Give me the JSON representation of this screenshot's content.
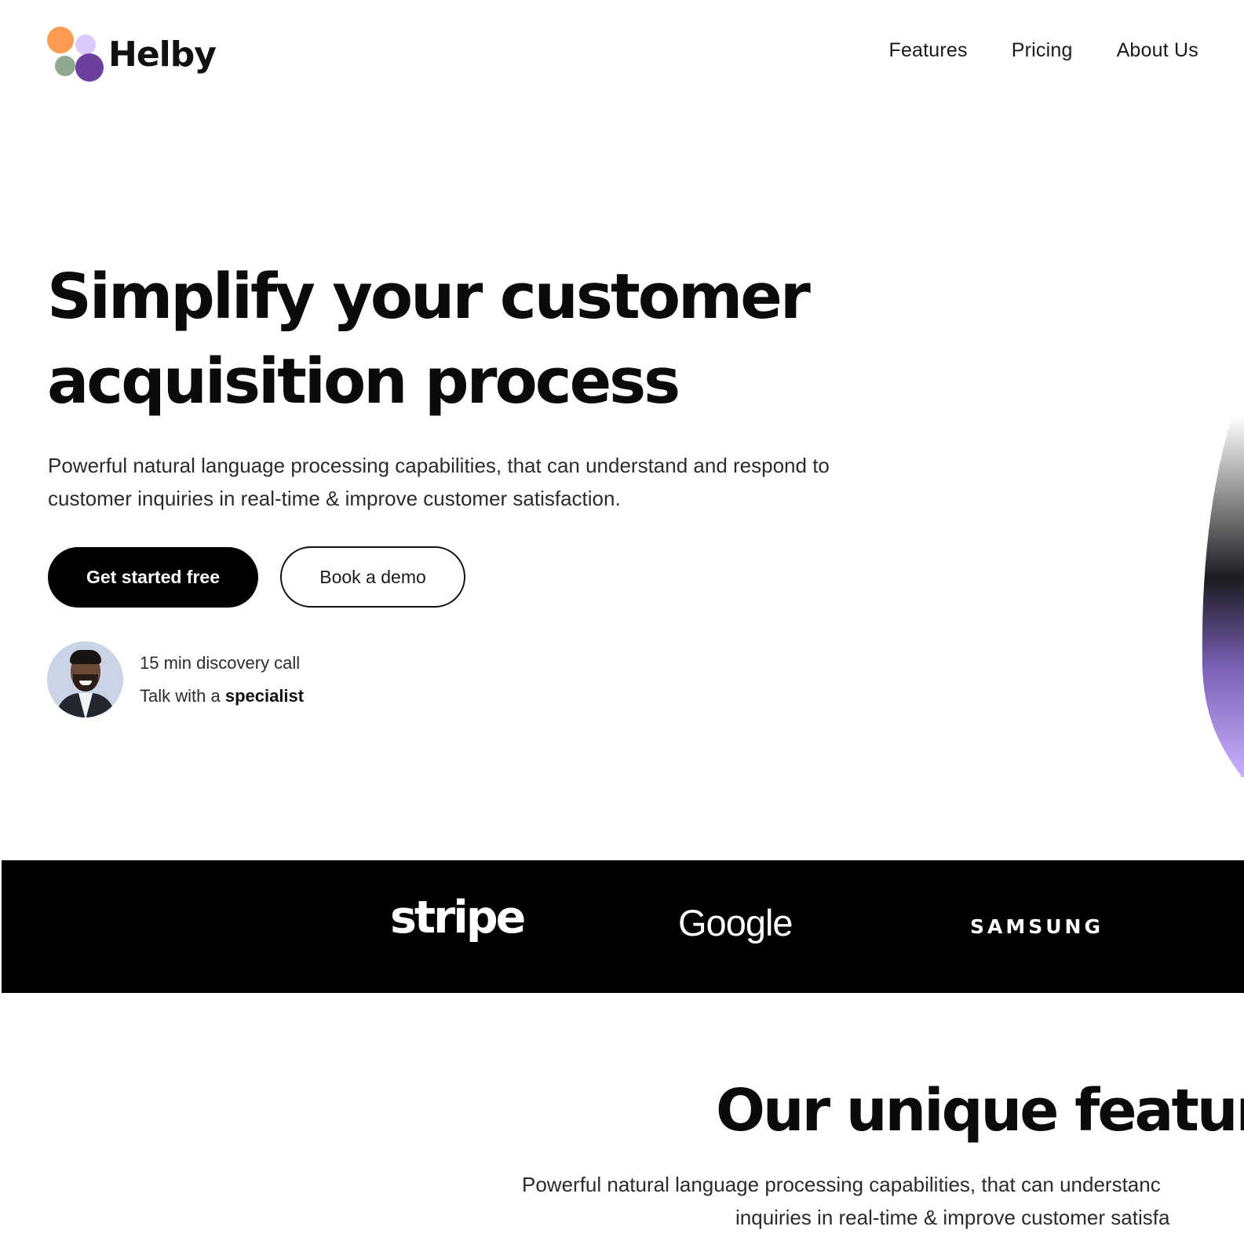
{
  "header": {
    "logo_text": "Helby",
    "logo_colors": [
      "#FF9A52",
      "#D9C9FF",
      "#8FA890",
      "#6B3FA0"
    ],
    "nav": [
      "Features",
      "Pricing",
      "About Us"
    ]
  },
  "hero": {
    "title_line1": "Simplify your customer",
    "title_line2": "acquisition process",
    "subtitle_line1": "Powerful natural language processing capabilities, that can understand and respond to",
    "subtitle_line2": "customer inquiries in real-time & improve customer satisfaction.",
    "primary_cta": "Get started free",
    "secondary_cta": "Book a demo",
    "specialist": {
      "line1": "15 min discovery call",
      "line2_prefix": "Talk with a ",
      "line2_bold": "specialist"
    }
  },
  "brands": [
    "stripe",
    "Google",
    "SAMSUNG"
  ],
  "features": {
    "title": "Our unique featur",
    "subtitle_line1": "Powerful natural language processing capabilities, that can understanc",
    "subtitle_line2": "inquiries in real-time & improve customer satisfa"
  },
  "colors": {
    "text": "#0b0b0b",
    "strip_background": "#000000",
    "accent_purple": "#C9B0FF"
  }
}
